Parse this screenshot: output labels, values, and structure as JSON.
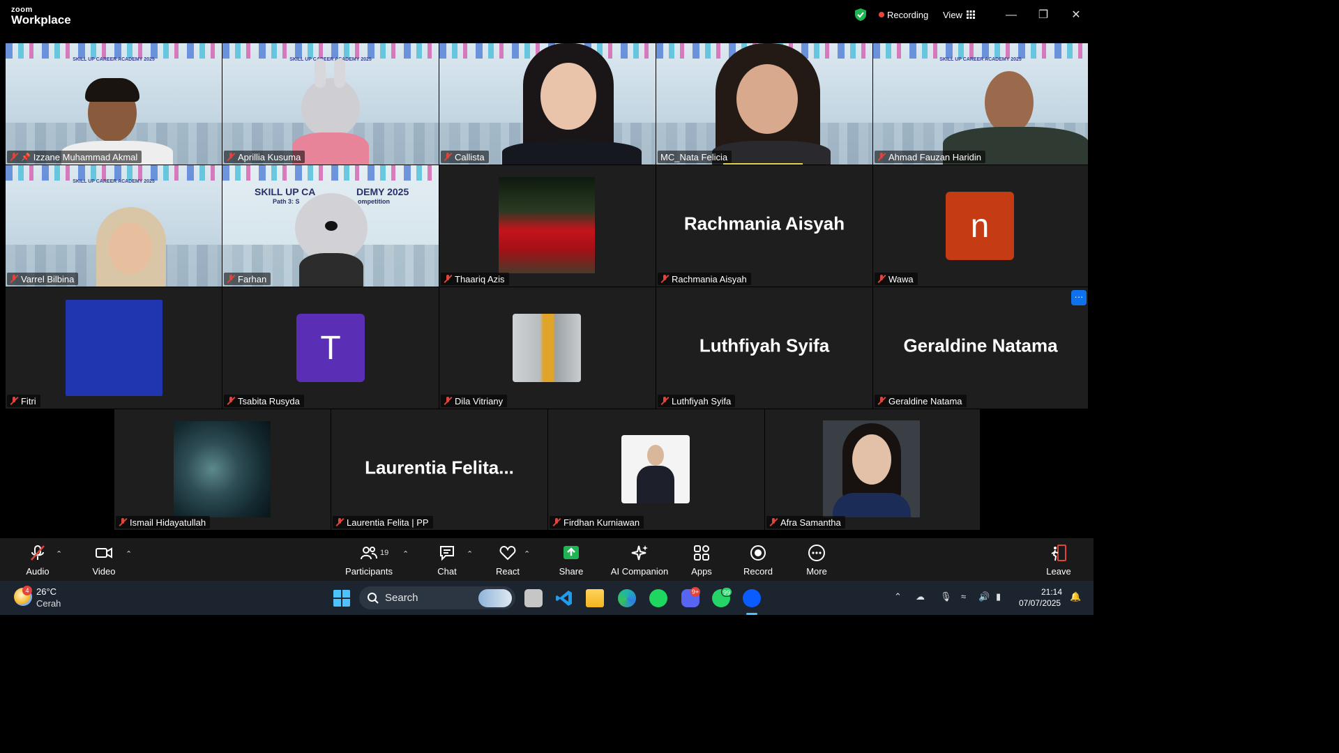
{
  "titlebar": {
    "brand_small": "zoom",
    "brand_big": "Workplace",
    "recording_label": "Recording",
    "view_label": "View"
  },
  "banner_text": "SKILL UP CAREER ACADEMY 2025",
  "participants": {
    "row1": [
      {
        "name": "Izzane Muhammad Akmal",
        "pinned": true,
        "active_speaker": true
      },
      {
        "name": "Aprillia Kusuma"
      },
      {
        "name": "Callista"
      },
      {
        "name": "MC_Nata Felicia"
      },
      {
        "name": "Ahmad Fauzan Haridin"
      }
    ],
    "row2": [
      {
        "name": "Varrel Bilbina"
      },
      {
        "name": "Farhan"
      },
      {
        "name": "Thaariq Azis"
      },
      {
        "name": "Rachmania Aisyah",
        "display": "Rachmania Aisyah"
      },
      {
        "name": "Wawa",
        "avatar_letter": "n"
      }
    ],
    "row3": [
      {
        "name": "Fitri"
      },
      {
        "name": "Tsabita Rusyda",
        "avatar_letter": "T"
      },
      {
        "name": "Dila Vitriany"
      },
      {
        "name": "Luthfiyah Syifa",
        "display": "Luthfiyah Syifa"
      },
      {
        "name": "Geraldine Natama",
        "display": "Geraldine Natama"
      }
    ],
    "row4": [
      {
        "name": "Ismail Hidayatullah"
      },
      {
        "name": "Laurentia Felita | PP",
        "display": "Laurentia  Felita..."
      },
      {
        "name": "Firdhan Kurniawan"
      },
      {
        "name": "Afra Samantha"
      }
    ]
  },
  "farhan_banner": {
    "line1": "SKILL UP CA",
    "line2": "DEMY 2025",
    "sub1": "Path 3: S",
    "sub2": "ompetition"
  },
  "more_dots": "···",
  "toolbar": {
    "audio": "Audio",
    "video": "Video",
    "participants": "Participants",
    "participants_count": "19",
    "chat": "Chat",
    "react": "React",
    "share": "Share",
    "ai_companion": "AI Companion",
    "apps": "Apps",
    "record": "Record",
    "more": "More",
    "leave": "Leave"
  },
  "taskbar": {
    "temperature": "26°C",
    "weather": "Cerah",
    "weather_badge": "4",
    "search": "Search",
    "discord_badge": "9+",
    "whatsapp_badge": "99",
    "time": "21:14",
    "date": "07/07/2025"
  },
  "colors": {
    "active_speaker": "#23d160",
    "wawa_avatar": "#c43b14",
    "tsabita_avatar": "#5b2fb5",
    "fitri_avatar": "#2035b0",
    "zoom_blue": "#0e72ed",
    "muted_red": "#e0443b"
  }
}
